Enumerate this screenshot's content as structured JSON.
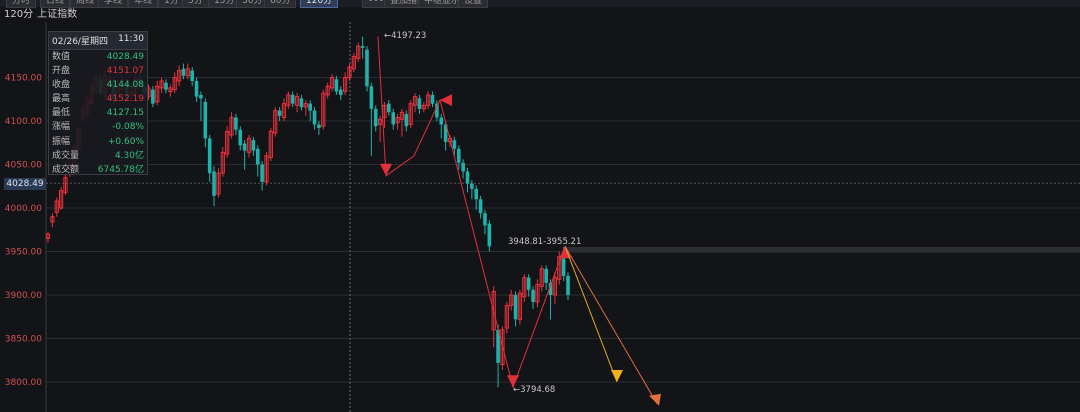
{
  "toolbar": {
    "buttons": [
      "分时",
      "日线",
      "周线",
      "季线",
      "年线",
      "1分",
      "5分",
      "15分",
      "30分",
      "60分",
      "120分",
      "•••",
      "叠加指数",
      "中枢显示",
      "设置"
    ],
    "active": "120分"
  },
  "header": {
    "period": "120分",
    "name": "上证指数"
  },
  "info_box": {
    "date": "02/26/星期四",
    "time": "11:30",
    "rows": [
      {
        "label": "数值",
        "value": "4028.49",
        "color": "down"
      },
      {
        "label": "开盘",
        "value": "4151.07",
        "color": "up"
      },
      {
        "label": "收盘",
        "value": "4144.08",
        "color": "down"
      },
      {
        "label": "最高",
        "value": "4152.19",
        "color": "up"
      },
      {
        "label": "最低",
        "value": "4127.15",
        "color": "down"
      },
      {
        "label": "涨幅",
        "value": "-0.08%",
        "color": "down"
      },
      {
        "label": "振幅",
        "value": "+0.60%",
        "color": "down"
      },
      {
        "label": "成交量",
        "value": "4.30亿",
        "color": "down"
      },
      {
        "label": "成交额",
        "value": "6745.78亿",
        "color": "down"
      }
    ]
  },
  "current_value": "4028.49",
  "colors": {
    "up": "#e8323c",
    "down": "#20b2aa",
    "bg": "#131418",
    "grid": "#2a2c31"
  },
  "chart_data": {
    "type": "candlestick",
    "yticks": [
      4150.0,
      4100.0,
      4050.0,
      4000.0,
      3950.0,
      3900.0,
      3850.0,
      3800.0
    ],
    "ylim": [
      3778,
      4218
    ],
    "annotations": [
      {
        "text": "4197.23",
        "kind": "high"
      },
      {
        "text": "3948.81-3955.21",
        "kind": "range"
      },
      {
        "text": "3794.68",
        "kind": "low"
      }
    ],
    "candles": [
      [
        3970,
        3965,
        3972,
        3960
      ],
      [
        3990,
        3984,
        3994,
        3978
      ],
      [
        4008,
        3995,
        4012,
        3990
      ],
      [
        4020,
        4000,
        4024,
        3998
      ],
      [
        4035,
        4018,
        4040,
        4015
      ],
      [
        4050,
        4040,
        4056,
        4036
      ],
      [
        4070,
        4048,
        4074,
        4045
      ],
      [
        4090,
        4068,
        4095,
        4066
      ],
      [
        4112,
        4102,
        4118,
        4098
      ],
      [
        4125,
        4108,
        4130,
        4104
      ],
      [
        4140,
        4120,
        4146,
        4118
      ],
      [
        4150,
        4135,
        4156,
        4130
      ],
      [
        4132,
        4148,
        4152,
        4128
      ],
      [
        4152,
        4128,
        4158,
        4124
      ],
      [
        4148,
        4140,
        4156,
        4136
      ],
      [
        4125,
        4146,
        4150,
        4120
      ],
      [
        4140,
        4126,
        4146,
        4122
      ],
      [
        4146,
        4136,
        4152,
        4132
      ],
      [
        4128,
        4144,
        4148,
        4124
      ],
      [
        4134,
        4130,
        4140,
        4122
      ],
      [
        4150,
        4132,
        4156,
        4128
      ],
      [
        4140,
        4148,
        4154,
        4136
      ],
      [
        4132,
        4140,
        4144,
        4126
      ],
      [
        4138,
        4128,
        4142,
        4124
      ],
      [
        4120,
        4136,
        4140,
        4116
      ],
      [
        4140,
        4122,
        4146,
        4118
      ],
      [
        4146,
        4138,
        4150,
        4132
      ],
      [
        4136,
        4144,
        4148,
        4132
      ],
      [
        4138,
        4134,
        4142,
        4128
      ],
      [
        4150,
        4136,
        4156,
        4132
      ],
      [
        4158,
        4146,
        4164,
        4140
      ],
      [
        4152,
        4160,
        4166,
        4148
      ],
      [
        4160,
        4152,
        4166,
        4148
      ],
      [
        4146,
        4158,
        4162,
        4140
      ],
      [
        4128,
        4146,
        4150,
        4122
      ],
      [
        4126,
        4130,
        4134,
        4100
      ],
      [
        4080,
        4122,
        4126,
        4070
      ],
      [
        4040,
        4080,
        4084,
        4030
      ],
      [
        4014,
        4042,
        4048,
        4002
      ],
      [
        4040,
        4016,
        4046,
        4012
      ],
      [
        4064,
        4040,
        4070,
        4036
      ],
      [
        4088,
        4062,
        4094,
        4058
      ],
      [
        4104,
        4084,
        4110,
        4080
      ],
      [
        4090,
        4104,
        4108,
        4084
      ],
      [
        4072,
        4090,
        4094,
        4066
      ],
      [
        4066,
        4074,
        4078,
        4044
      ],
      [
        4080,
        4064,
        4084,
        4058
      ],
      [
        4066,
        4078,
        4082,
        4060
      ],
      [
        4050,
        4068,
        4072,
        4036
      ],
      [
        4030,
        4050,
        4054,
        4020
      ],
      [
        4060,
        4030,
        4064,
        4026
      ],
      [
        4088,
        4058,
        4092,
        4054
      ],
      [
        4112,
        4086,
        4116,
        4082
      ],
      [
        4106,
        4112,
        4116,
        4100
      ],
      [
        4120,
        4104,
        4126,
        4100
      ],
      [
        4130,
        4118,
        4134,
        4114
      ],
      [
        4120,
        4130,
        4134,
        4116
      ],
      [
        4128,
        4118,
        4132,
        4110
      ],
      [
        4116,
        4126,
        4130,
        4112
      ],
      [
        4120,
        4116,
        4124,
        4106
      ],
      [
        4112,
        4120,
        4124,
        4100
      ],
      [
        4096,
        4112,
        4116,
        4090
      ],
      [
        4092,
        4096,
        4100,
        4084
      ],
      [
        4132,
        4094,
        4136,
        4090
      ],
      [
        4140,
        4130,
        4144,
        4126
      ],
      [
        4150,
        4138,
        4154,
        4134
      ],
      [
        4134,
        4148,
        4152,
        4130
      ],
      [
        4130,
        4136,
        4140,
        4124
      ],
      [
        4150,
        4134,
        4156,
        4130
      ],
      [
        4162,
        4150,
        4166,
        4146
      ],
      [
        4174,
        4160,
        4178,
        4156
      ],
      [
        4186,
        4172,
        4190,
        4168
      ],
      [
        4184,
        4186,
        4197,
        4172
      ],
      [
        4140,
        4182,
        4186,
        4134
      ],
      [
        4114,
        4140,
        4144,
        4060
      ],
      [
        4094,
        4114,
        4118,
        4088
      ],
      [
        4102,
        4096,
        4106,
        4076
      ],
      [
        4118,
        4104,
        4122,
        4092
      ],
      [
        4110,
        4120,
        4124,
        4106
      ],
      [
        4096,
        4110,
        4114,
        4090
      ],
      [
        4104,
        4098,
        4108,
        4090
      ],
      [
        4110,
        4102,
        4114,
        4082
      ],
      [
        4094,
        4108,
        4112,
        4088
      ],
      [
        4120,
        4096,
        4124,
        4092
      ],
      [
        4128,
        4118,
        4132,
        4110
      ],
      [
        4114,
        4126,
        4130,
        4108
      ],
      [
        4118,
        4114,
        4122,
        4110
      ],
      [
        4130,
        4118,
        4134,
        4114
      ],
      [
        4120,
        4130,
        4134,
        4116
      ],
      [
        4104,
        4120,
        4124,
        4100
      ],
      [
        4096,
        4104,
        4108,
        4080
      ],
      [
        4076,
        4096,
        4100,
        4066
      ],
      [
        4080,
        4076,
        4084,
        4070
      ],
      [
        4068,
        4078,
        4082,
        4060
      ],
      [
        4052,
        4068,
        4072,
        4044
      ],
      [
        4042,
        4052,
        4056,
        4034
      ],
      [
        4028,
        4042,
        4046,
        4018
      ],
      [
        4022,
        4028,
        4032,
        4010
      ],
      [
        4010,
        4022,
        4026,
        3998
      ],
      [
        3994,
        4010,
        4014,
        3988
      ],
      [
        3980,
        3994,
        3998,
        3970
      ],
      [
        3956,
        3982,
        3986,
        3950
      ],
      [
        3904,
        3860,
        3910,
        3840
      ],
      [
        3822,
        3860,
        3866,
        3794
      ],
      [
        3860,
        3820,
        3864,
        3814
      ],
      [
        3888,
        3862,
        3892,
        3856
      ],
      [
        3900,
        3888,
        3906,
        3882
      ],
      [
        3872,
        3900,
        3904,
        3864
      ],
      [
        3902,
        3872,
        3906,
        3866
      ],
      [
        3920,
        3898,
        3924,
        3892
      ],
      [
        3906,
        3920,
        3924,
        3898
      ],
      [
        3892,
        3906,
        3910,
        3884
      ],
      [
        3912,
        3892,
        3918,
        3886
      ],
      [
        3930,
        3910,
        3934,
        3904
      ],
      [
        3914,
        3930,
        3934,
        3906
      ],
      [
        3900,
        3914,
        3918,
        3872
      ],
      [
        3920,
        3900,
        3926,
        3890
      ],
      [
        3944,
        3918,
        3950,
        3912
      ],
      [
        3922,
        3942,
        3955,
        3916
      ],
      [
        3900,
        3922,
        3926,
        3894
      ]
    ]
  }
}
